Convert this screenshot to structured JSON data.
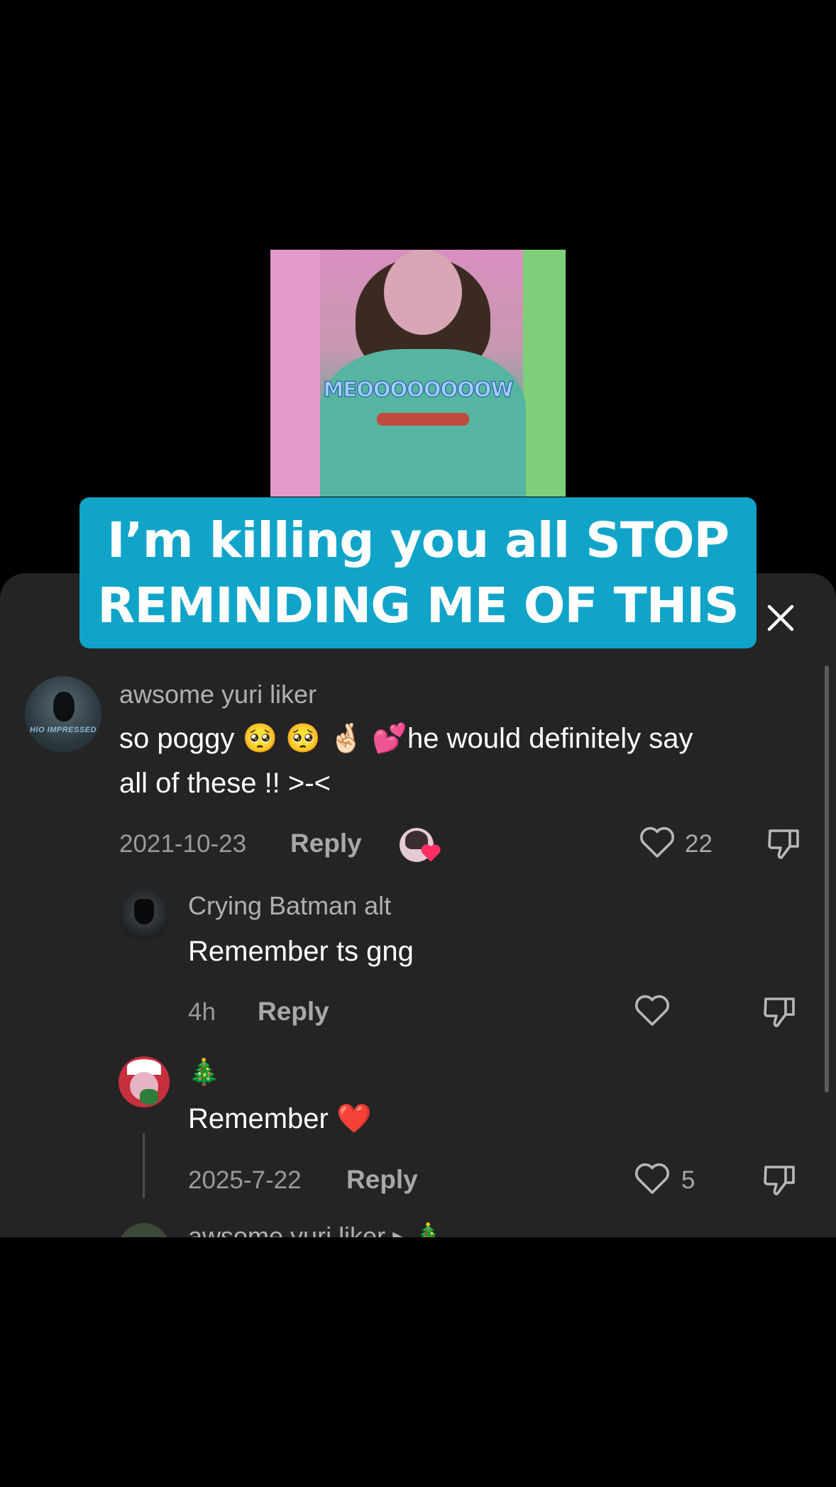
{
  "video": {
    "caption": "MEOOOOOOOOW"
  },
  "overlay": {
    "line1": "I’m killing you all STOP",
    "line2": "REMINDING ME OF THIS"
  },
  "comments": [
    {
      "username": "awsome yuri liker",
      "avatar_text": "HIO IMPRESSED",
      "text_line1": "so poggy 🥺 🥺 🤞🏻 💕he would definitely say",
      "text_line2": "all of these !! >-<",
      "date": "2021-10-23",
      "reply_label": "Reply",
      "likes": "22"
    },
    {
      "username": "Crying Batman alt",
      "text_line1": "Remember ts gng",
      "date": "4h",
      "reply_label": "Reply",
      "likes": ""
    },
    {
      "username": "🎄",
      "text_line1": "Remember ❤️",
      "date": "2025-7-22",
      "reply_label": "Reply",
      "likes": "5"
    },
    {
      "username": "awsome yuri liker ▸ 🎄"
    }
  ],
  "colors": {
    "banner": "#11a4c9",
    "sheet": "#242424",
    "background": "#000000"
  },
  "icons": [
    "close-icon",
    "heart-icon",
    "dislike-icon"
  ]
}
